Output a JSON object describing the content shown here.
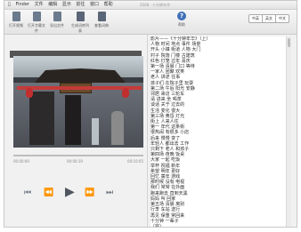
{
  "menubar": {
    "apple": "",
    "items": [
      "Finder",
      "文件",
      "编辑",
      "显示",
      "前往",
      "窗口",
      "帮助"
    ]
  },
  "window_title": "2008 · 十分钟年华",
  "toolbar": {
    "buttons": [
      {
        "label": "打开视频",
        "icon": "open-icon"
      },
      {
        "label": "打开字幕文件",
        "icon": "subtitle-icon"
      },
      {
        "label": "导出文件",
        "icon": "export-icon"
      },
      {
        "label": "生成词库列表",
        "icon": "wordlist-icon"
      },
      {
        "label": "查看词典",
        "icon": "dictionary-icon"
      },
      {
        "label": "帮助",
        "icon": "help-icon"
      }
    ],
    "segments": [
      "中英",
      "英文",
      "中文"
    ]
  },
  "video": {
    "timeline_left": "00:00:00",
    "timeline_center": "00:00:19",
    "timeline_right": "00:10:05"
  },
  "controls": {
    "first": "⏮",
    "rewind": "⏪",
    "play": "▶",
    "forward": "⏩",
    "last": "⏭"
  },
  "subtitles": [
    "影片——《十分钟年华》（上）",
    "人物  时间  地点  事件  场景",
    "开头 小镇  街道  人物  大门",
    "村子  院落  门楼  古建筑",
    "红色  灯笼  过年  喜庆",
    "第一场  清晨  门口  等待",
    "一家人  团聚  欢笑",
    "老人  讲述  往事",
    "孩子们  在院子里  玩耍",
    "第二场  午后  阳光  安静",
    "邻居  来访  三轮车",
    "请  进来  坐  喝茶",
    "谈话  关于  过去的",
    "生活  变化  很大",
    "第三场  黄昏  灯光",
    "街上  人来人往",
    "第一  年代  这条街",
    "很热闹  有很多  小店",
    "后来  慢慢  变了",
    "年轻人  都出去  工作",
    "只剩下  老人  和孩子",
    "第四场  夜晚  饭桌",
    "大家  一起  吃饭",
    "举杯  祝福  新年",
    "希望  明年  更好",
    "回忆  童年  游戏",
    "那时候  没有  电视",
    "我们  常常  在外面",
    "跑来跑去  直到天黑",
    "妈妈  叫  回家",
    "第五场  清晨  离别",
    "行李  车站  送行",
    "再见  保重  常回来",
    "十分钟  一辈子",
    "（完）"
  ]
}
